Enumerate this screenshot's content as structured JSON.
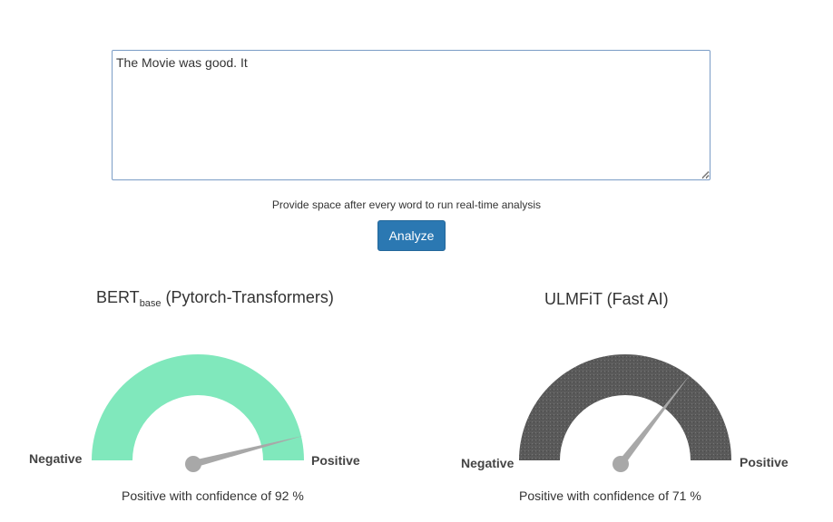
{
  "input": {
    "value": "The Movie was good. It "
  },
  "hint": "Provide space after every word to run real-time analysis",
  "analyze_label": "Analyze",
  "gauges": [
    {
      "title_main": "BERT",
      "title_sub": "base",
      "title_rest": " (Pytorch-Transformers)",
      "negative_label": "Negative",
      "positive_label": "Positive",
      "confidence_prefix": "Positive with confidence of ",
      "confidence_value": "92",
      "confidence_suffix": " %",
      "level": 0.92,
      "arc_color": "#80e8bc"
    },
    {
      "title_main": "ULMFiT (Fast AI)",
      "negative_label": "Negative",
      "positive_label": "Positive",
      "confidence_prefix": "Positive with confidence of ",
      "confidence_value": "71",
      "confidence_suffix": " %",
      "level": 0.71,
      "arc_color": "#5a5a5a"
    }
  ],
  "colors": {
    "button": "#2b78b2",
    "needle": "#a8a8a8"
  }
}
